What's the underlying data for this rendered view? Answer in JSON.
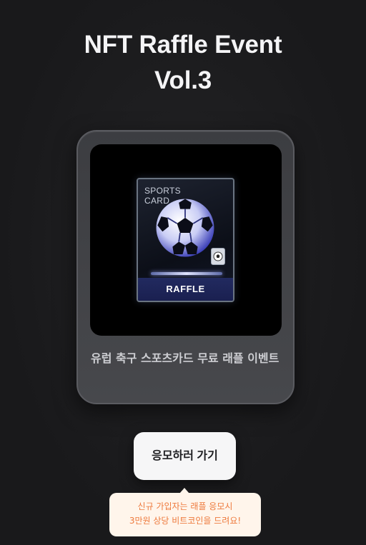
{
  "header": {
    "title_line1": "NFT Raffle Event",
    "title_line2": "Vol.3"
  },
  "card": {
    "image": {
      "card_label_line1": "SPORTS",
      "card_label_line2": "CARD",
      "band_label": "RAFFLE",
      "icon": "soccer-ball-icon"
    },
    "caption": "유럽 축구 스포츠카드 무료 래플 이벤트"
  },
  "cta": {
    "button_label": "응모하러 가기"
  },
  "tooltip": {
    "line1": "신규 가입자는 래플 응모시",
    "line2": "3만원 상당 비트코인을 드려요!"
  },
  "colors": {
    "background": "#19191b",
    "tooltip_text": "#ee7a3d",
    "tooltip_bg": "#fff5eb",
    "raffle_band": "#222a60"
  }
}
